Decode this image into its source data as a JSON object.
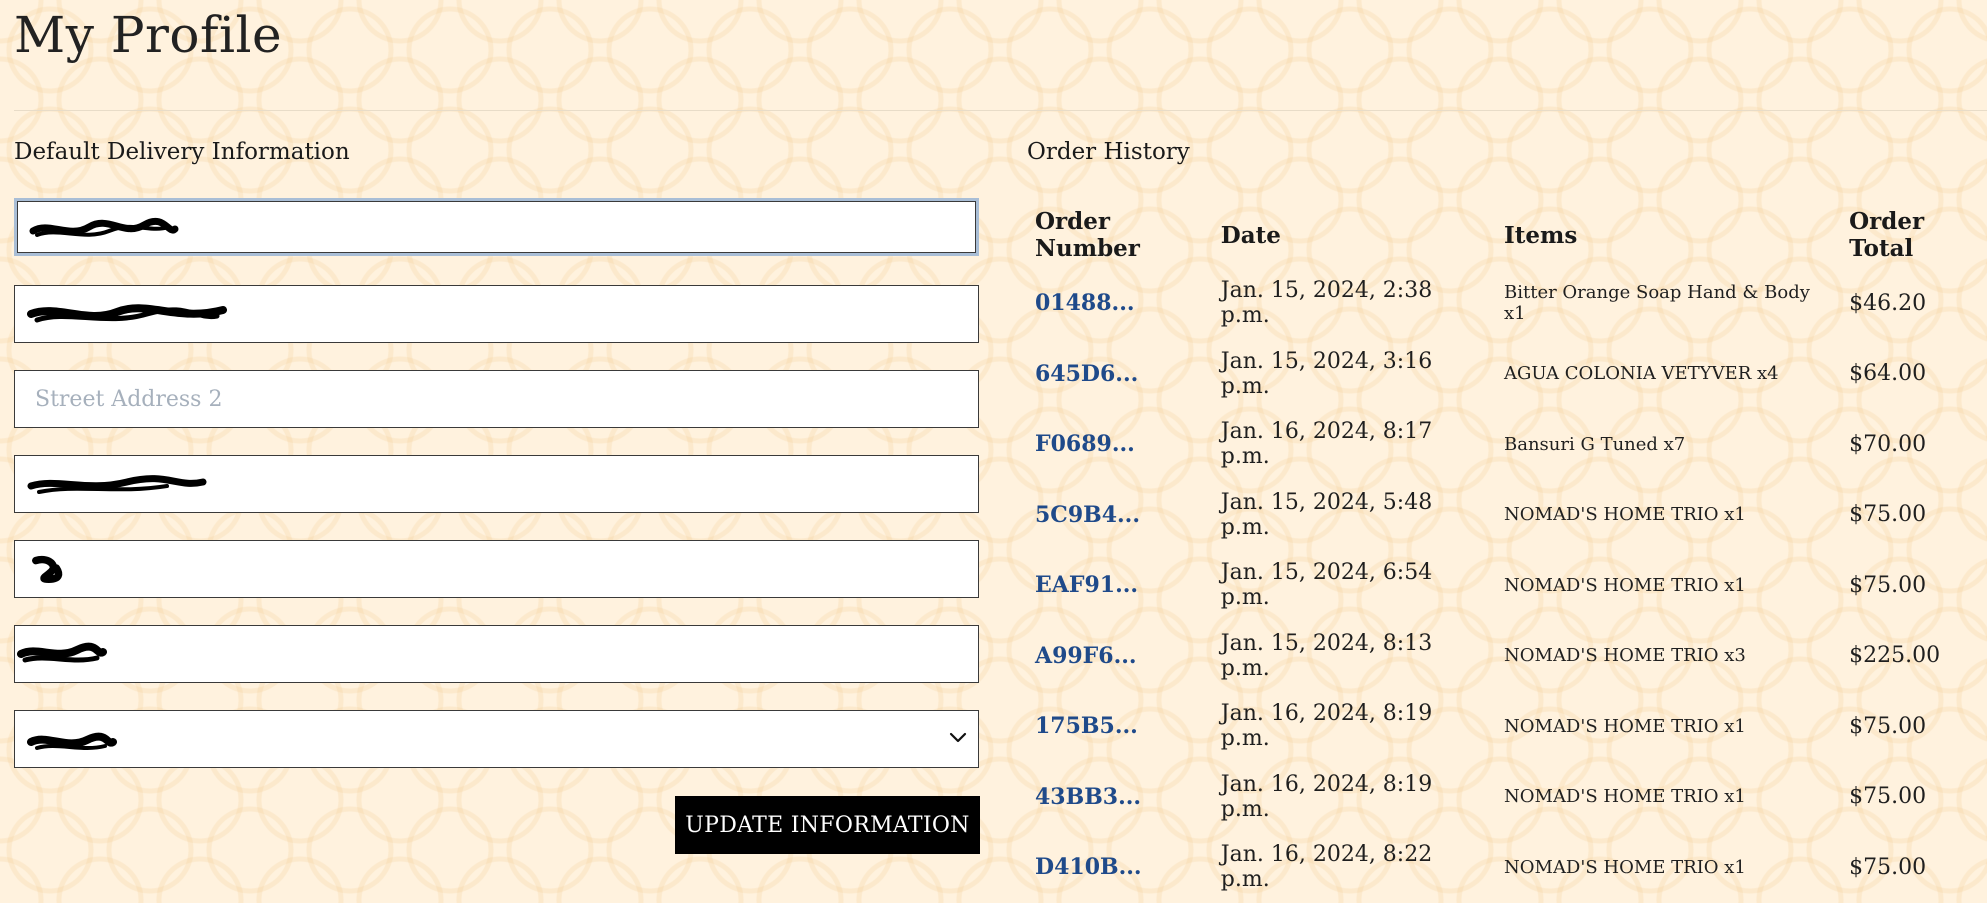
{
  "page": {
    "title": "My Profile"
  },
  "delivery": {
    "section_title": "Default Delivery Information",
    "fields": [
      {
        "name": "phone-number-field",
        "value": "",
        "placeholder": "",
        "redacted": true
      },
      {
        "name": "street-address-1-field",
        "value": "",
        "placeholder": "",
        "redacted": true
      },
      {
        "name": "street-address-2-field",
        "value": "",
        "placeholder": "Street Address 2",
        "redacted": false
      },
      {
        "name": "town-city-field",
        "value": "",
        "placeholder": "",
        "redacted": true
      },
      {
        "name": "county-field",
        "value": "",
        "placeholder": "",
        "redacted": true
      },
      {
        "name": "postcode-field",
        "value": "",
        "placeholder": "",
        "redacted": true
      },
      {
        "name": "country-select",
        "value": "",
        "placeholder": "",
        "redacted": true,
        "icon": "chevron-down-icon"
      }
    ],
    "update_button_label": "UPDATE INFORMATION"
  },
  "orders": {
    "section_title": "Order History",
    "columns": [
      "Order Number",
      "Date",
      "Items",
      "Order Total"
    ],
    "rows": [
      {
        "number": "01488...",
        "date": "Jan. 15, 2024, 2:38 p.m.",
        "items": "Bitter Orange Soap Hand & Body x1",
        "total": "$46.20"
      },
      {
        "number": "645D6...",
        "date": "Jan. 15, 2024, 3:16 p.m.",
        "items": "AGUA COLONIA VETYVER x4",
        "total": "$64.00"
      },
      {
        "number": "F0689...",
        "date": "Jan. 16, 2024, 8:17 p.m.",
        "items": "Bansuri G Tuned x7",
        "total": "$70.00"
      },
      {
        "number": "5C9B4...",
        "date": "Jan. 15, 2024, 5:48 p.m.",
        "items": "NOMAD'S HOME TRIO x1",
        "total": "$75.00"
      },
      {
        "number": "EAF91...",
        "date": "Jan. 15, 2024, 6:54 p.m.",
        "items": "NOMAD'S HOME TRIO x1",
        "total": "$75.00"
      },
      {
        "number": "A99F6...",
        "date": "Jan. 15, 2024, 8:13 p.m.",
        "items": "NOMAD'S HOME TRIO x3",
        "total": "$225.00"
      },
      {
        "number": "175B5...",
        "date": "Jan. 16, 2024, 8:19 p.m.",
        "items": "NOMAD'S HOME TRIO x1",
        "total": "$75.00"
      },
      {
        "number": "43BB3...",
        "date": "Jan. 16, 2024, 8:19 p.m.",
        "items": "NOMAD'S HOME TRIO x1",
        "total": "$75.00"
      },
      {
        "number": "D410B...",
        "date": "Jan. 16, 2024, 8:22 p.m.",
        "items": "NOMAD'S HOME TRIO x1",
        "total": "$75.00"
      }
    ]
  },
  "colors": {
    "background": "#fff2de",
    "link": "#1f4a8a",
    "button_bg": "#000000",
    "button_text": "#ffffff",
    "focus_ring": "#a9bed6"
  }
}
